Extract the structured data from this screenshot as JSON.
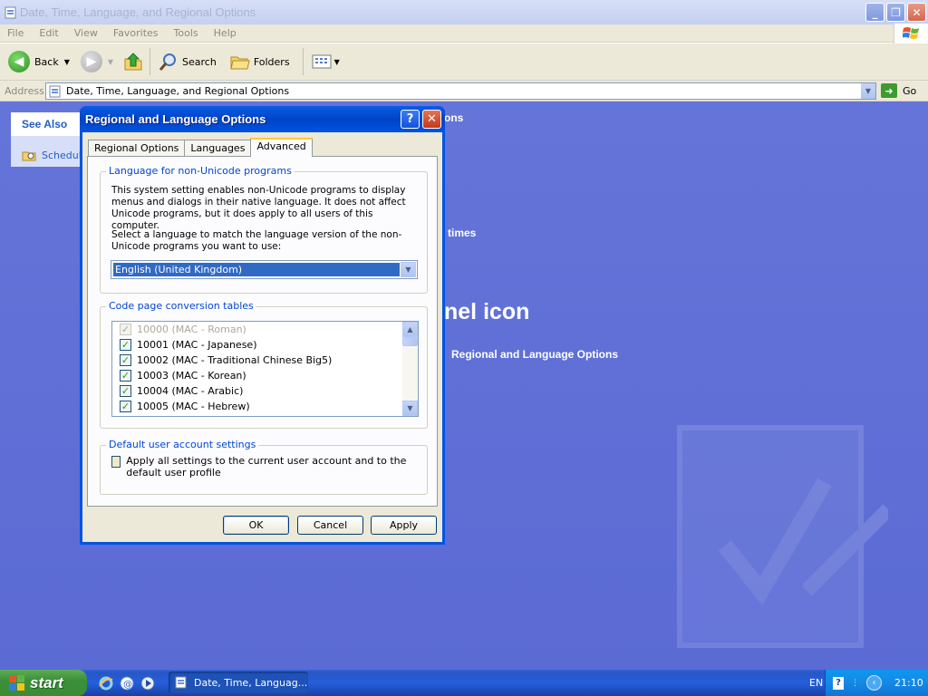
{
  "window": {
    "title": "Date, Time, Language, and Regional Options",
    "menu": [
      "File",
      "Edit",
      "View",
      "Favorites",
      "Tools",
      "Help"
    ],
    "toolbar": {
      "back_label": "Back",
      "search_label": "Search",
      "folders_label": "Folders"
    },
    "address": {
      "label": "Address",
      "value": "Date, Time, Language, and Regional Options",
      "go_label": "Go"
    }
  },
  "panel": {
    "see_also_title": "See Also",
    "see_also_item": "Schedule",
    "bg_text_1": "ons",
    "bg_text_2": "times",
    "bg_heading": "nel icon",
    "bg_link": "Regional and Language Options"
  },
  "dialog": {
    "title": "Regional and Language Options",
    "help_label": "?",
    "close_label": "✕",
    "tabs": [
      {
        "label": "Regional Options",
        "active": false
      },
      {
        "label": "Languages",
        "active": false
      },
      {
        "label": "Advanced",
        "active": true
      }
    ],
    "group_nonunicode": {
      "title": "Language for non-Unicode programs",
      "para1": "This system setting enables non-Unicode programs to display menus and dialogs in their native language. It does not affect Unicode programs, but it does apply to all users of this computer.",
      "para2": "Select a language to match the language version of the non-Unicode programs you want to use:",
      "selected": "English (United Kingdom)"
    },
    "group_codepage": {
      "title": "Code page conversion tables",
      "items": [
        {
          "label": "10000 (MAC - Roman)",
          "checked": true,
          "disabled": true
        },
        {
          "label": "10001 (MAC - Japanese)",
          "checked": true,
          "disabled": false
        },
        {
          "label": "10002 (MAC - Traditional Chinese Big5)",
          "checked": true,
          "disabled": false
        },
        {
          "label": "10003 (MAC - Korean)",
          "checked": true,
          "disabled": false
        },
        {
          "label": "10004 (MAC - Arabic)",
          "checked": true,
          "disabled": false
        },
        {
          "label": "10005 (MAC - Hebrew)",
          "checked": true,
          "disabled": false
        }
      ]
    },
    "group_default": {
      "title": "Default user account settings",
      "checkbox_label": "Apply all settings to the current user account and to the default user profile"
    },
    "buttons": {
      "ok": "OK",
      "cancel": "Cancel",
      "apply": "Apply"
    }
  },
  "taskbar": {
    "start_label": "start",
    "task_label": "Date, Time, Languag...",
    "lang": "EN",
    "clock": "21:10"
  }
}
